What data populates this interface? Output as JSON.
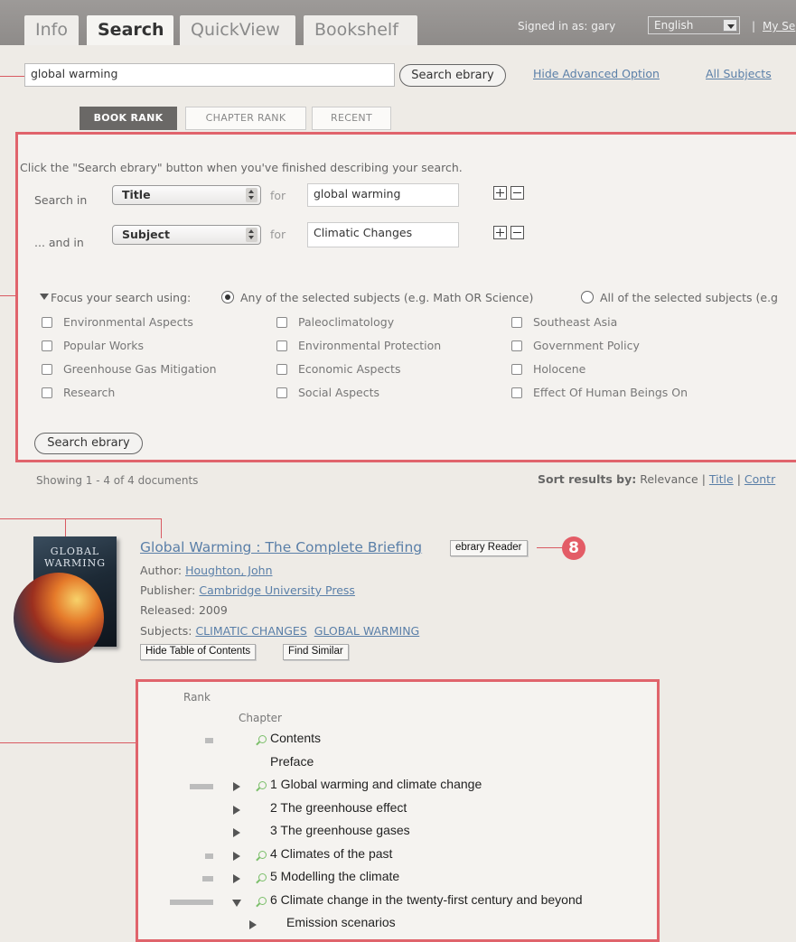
{
  "header": {
    "tabs": [
      {
        "label": "Info"
      },
      {
        "label": "Search"
      },
      {
        "label": "QuickView"
      },
      {
        "label": "Bookshelf"
      }
    ],
    "signed_in": "Signed in as: gary",
    "language": "English",
    "my_settings": "My Se"
  },
  "search": {
    "query": "global warming",
    "button": "Search ebrary",
    "hide_advanced": "Hide Advanced Option",
    "all_subjects": "All Subjects"
  },
  "rank_tabs": [
    "BOOK RANK",
    "CHAPTER RANK",
    "RECENT"
  ],
  "advanced": {
    "instruction": "Click the \"Search ebrary\" button when you've finished describing your search.",
    "row1": {
      "label": "Search in",
      "field": "Title",
      "for": "for",
      "value": "global warming"
    },
    "row2": {
      "label": "... and in",
      "field": "Subject",
      "for": "for",
      "value": "Climatic Changes"
    },
    "focus_label": "Focus your search using:",
    "focus_any": "Any of the selected subjects (e.g. Math OR Science)",
    "focus_all": "All of the selected subjects (e.g",
    "subjects": [
      "Environmental Aspects",
      "Paleoclimatology",
      "Southeast Asia",
      "Popular Works",
      "Environmental Protection",
      "Government Policy",
      "Greenhouse Gas Mitigation",
      "Economic Aspects",
      "Holocene",
      "Research",
      "Social Aspects",
      "Effect Of Human Beings On"
    ],
    "button": "Search ebrary"
  },
  "results": {
    "showing": "Showing 1 - 4 of 4 documents",
    "sort_label": "Sort results by:",
    "sort_relevance": "Relevance",
    "sort_title": "Title",
    "sort_contrib": "Contr"
  },
  "book": {
    "title": "Global Warming : The Complete Briefing",
    "reader_button": "ebrary Reader",
    "author_label": "Author:",
    "author": "Houghton, John",
    "publisher_label": "Publisher:",
    "publisher": "Cambridge University Press",
    "released": "Released: 2009",
    "subjects_label": "Subjects:",
    "subject1": "CLIMATIC CHANGES",
    "subject2": "GLOBAL WARMING",
    "hide_toc": "Hide Table of Contents",
    "find_similar": "Find Similar",
    "cover_line1": "GLOBAL",
    "cover_line2": "WARMING"
  },
  "callout_number": "8",
  "toc": {
    "rank_header": "Rank",
    "chapter_header": "Chapter",
    "rows": [
      {
        "label": "Contents",
        "rank": 0.18,
        "arrow": "none",
        "search": true
      },
      {
        "label": "Preface",
        "rank": 0,
        "arrow": "none",
        "search": false
      },
      {
        "label": "1 Global warming and climate change",
        "rank": 0.55,
        "arrow": "right",
        "search": true
      },
      {
        "label": "2 The greenhouse effect",
        "rank": 0,
        "arrow": "right",
        "search": false
      },
      {
        "label": "3 The greenhouse gases",
        "rank": 0,
        "arrow": "right",
        "search": false
      },
      {
        "label": "4 Climates of the past",
        "rank": 0.18,
        "arrow": "right",
        "search": true
      },
      {
        "label": "5 Modelling the climate",
        "rank": 0.24,
        "arrow": "right",
        "search": true
      },
      {
        "label": "6 Climate change in the twenty-first century and beyond",
        "rank": 1.0,
        "arrow": "down",
        "search": true
      },
      {
        "label": "Emission scenarios",
        "rank": 0,
        "arrow": "right",
        "search": false
      }
    ]
  }
}
